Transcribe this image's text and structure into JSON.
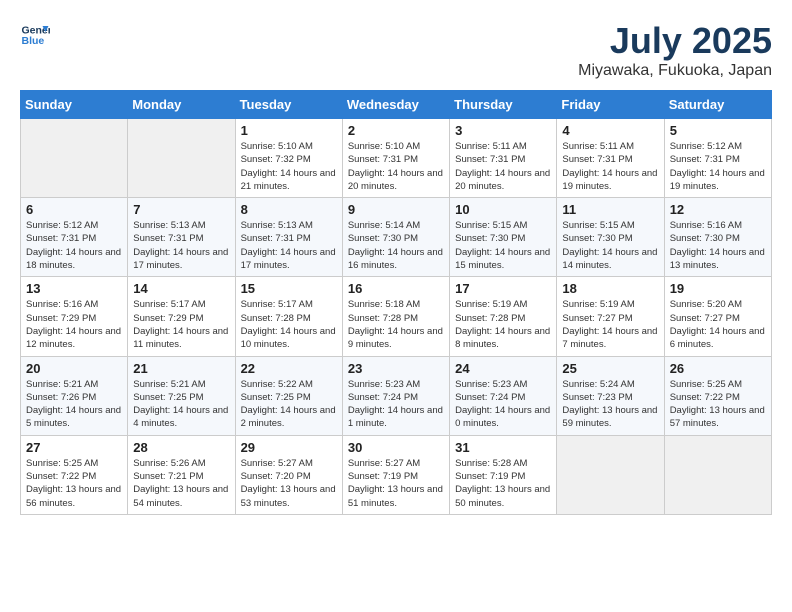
{
  "header": {
    "logo_line1": "General",
    "logo_line2": "Blue",
    "month_year": "July 2025",
    "location": "Miyawaka, Fukuoka, Japan"
  },
  "days_of_week": [
    "Sunday",
    "Monday",
    "Tuesday",
    "Wednesday",
    "Thursday",
    "Friday",
    "Saturday"
  ],
  "weeks": [
    [
      {
        "day": "",
        "sunrise": "",
        "sunset": "",
        "daylight": ""
      },
      {
        "day": "",
        "sunrise": "",
        "sunset": "",
        "daylight": ""
      },
      {
        "day": "1",
        "sunrise": "Sunrise: 5:10 AM",
        "sunset": "Sunset: 7:32 PM",
        "daylight": "Daylight: 14 hours and 21 minutes."
      },
      {
        "day": "2",
        "sunrise": "Sunrise: 5:10 AM",
        "sunset": "Sunset: 7:31 PM",
        "daylight": "Daylight: 14 hours and 20 minutes."
      },
      {
        "day": "3",
        "sunrise": "Sunrise: 5:11 AM",
        "sunset": "Sunset: 7:31 PM",
        "daylight": "Daylight: 14 hours and 20 minutes."
      },
      {
        "day": "4",
        "sunrise": "Sunrise: 5:11 AM",
        "sunset": "Sunset: 7:31 PM",
        "daylight": "Daylight: 14 hours and 19 minutes."
      },
      {
        "day": "5",
        "sunrise": "Sunrise: 5:12 AM",
        "sunset": "Sunset: 7:31 PM",
        "daylight": "Daylight: 14 hours and 19 minutes."
      }
    ],
    [
      {
        "day": "6",
        "sunrise": "Sunrise: 5:12 AM",
        "sunset": "Sunset: 7:31 PM",
        "daylight": "Daylight: 14 hours and 18 minutes."
      },
      {
        "day": "7",
        "sunrise": "Sunrise: 5:13 AM",
        "sunset": "Sunset: 7:31 PM",
        "daylight": "Daylight: 14 hours and 17 minutes."
      },
      {
        "day": "8",
        "sunrise": "Sunrise: 5:13 AM",
        "sunset": "Sunset: 7:31 PM",
        "daylight": "Daylight: 14 hours and 17 minutes."
      },
      {
        "day": "9",
        "sunrise": "Sunrise: 5:14 AM",
        "sunset": "Sunset: 7:30 PM",
        "daylight": "Daylight: 14 hours and 16 minutes."
      },
      {
        "day": "10",
        "sunrise": "Sunrise: 5:15 AM",
        "sunset": "Sunset: 7:30 PM",
        "daylight": "Daylight: 14 hours and 15 minutes."
      },
      {
        "day": "11",
        "sunrise": "Sunrise: 5:15 AM",
        "sunset": "Sunset: 7:30 PM",
        "daylight": "Daylight: 14 hours and 14 minutes."
      },
      {
        "day": "12",
        "sunrise": "Sunrise: 5:16 AM",
        "sunset": "Sunset: 7:30 PM",
        "daylight": "Daylight: 14 hours and 13 minutes."
      }
    ],
    [
      {
        "day": "13",
        "sunrise": "Sunrise: 5:16 AM",
        "sunset": "Sunset: 7:29 PM",
        "daylight": "Daylight: 14 hours and 12 minutes."
      },
      {
        "day": "14",
        "sunrise": "Sunrise: 5:17 AM",
        "sunset": "Sunset: 7:29 PM",
        "daylight": "Daylight: 14 hours and 11 minutes."
      },
      {
        "day": "15",
        "sunrise": "Sunrise: 5:17 AM",
        "sunset": "Sunset: 7:28 PM",
        "daylight": "Daylight: 14 hours and 10 minutes."
      },
      {
        "day": "16",
        "sunrise": "Sunrise: 5:18 AM",
        "sunset": "Sunset: 7:28 PM",
        "daylight": "Daylight: 14 hours and 9 minutes."
      },
      {
        "day": "17",
        "sunrise": "Sunrise: 5:19 AM",
        "sunset": "Sunset: 7:28 PM",
        "daylight": "Daylight: 14 hours and 8 minutes."
      },
      {
        "day": "18",
        "sunrise": "Sunrise: 5:19 AM",
        "sunset": "Sunset: 7:27 PM",
        "daylight": "Daylight: 14 hours and 7 minutes."
      },
      {
        "day": "19",
        "sunrise": "Sunrise: 5:20 AM",
        "sunset": "Sunset: 7:27 PM",
        "daylight": "Daylight: 14 hours and 6 minutes."
      }
    ],
    [
      {
        "day": "20",
        "sunrise": "Sunrise: 5:21 AM",
        "sunset": "Sunset: 7:26 PM",
        "daylight": "Daylight: 14 hours and 5 minutes."
      },
      {
        "day": "21",
        "sunrise": "Sunrise: 5:21 AM",
        "sunset": "Sunset: 7:25 PM",
        "daylight": "Daylight: 14 hours and 4 minutes."
      },
      {
        "day": "22",
        "sunrise": "Sunrise: 5:22 AM",
        "sunset": "Sunset: 7:25 PM",
        "daylight": "Daylight: 14 hours and 2 minutes."
      },
      {
        "day": "23",
        "sunrise": "Sunrise: 5:23 AM",
        "sunset": "Sunset: 7:24 PM",
        "daylight": "Daylight: 14 hours and 1 minute."
      },
      {
        "day": "24",
        "sunrise": "Sunrise: 5:23 AM",
        "sunset": "Sunset: 7:24 PM",
        "daylight": "Daylight: 14 hours and 0 minutes."
      },
      {
        "day": "25",
        "sunrise": "Sunrise: 5:24 AM",
        "sunset": "Sunset: 7:23 PM",
        "daylight": "Daylight: 13 hours and 59 minutes."
      },
      {
        "day": "26",
        "sunrise": "Sunrise: 5:25 AM",
        "sunset": "Sunset: 7:22 PM",
        "daylight": "Daylight: 13 hours and 57 minutes."
      }
    ],
    [
      {
        "day": "27",
        "sunrise": "Sunrise: 5:25 AM",
        "sunset": "Sunset: 7:22 PM",
        "daylight": "Daylight: 13 hours and 56 minutes."
      },
      {
        "day": "28",
        "sunrise": "Sunrise: 5:26 AM",
        "sunset": "Sunset: 7:21 PM",
        "daylight": "Daylight: 13 hours and 54 minutes."
      },
      {
        "day": "29",
        "sunrise": "Sunrise: 5:27 AM",
        "sunset": "Sunset: 7:20 PM",
        "daylight": "Daylight: 13 hours and 53 minutes."
      },
      {
        "day": "30",
        "sunrise": "Sunrise: 5:27 AM",
        "sunset": "Sunset: 7:19 PM",
        "daylight": "Daylight: 13 hours and 51 minutes."
      },
      {
        "day": "31",
        "sunrise": "Sunrise: 5:28 AM",
        "sunset": "Sunset: 7:19 PM",
        "daylight": "Daylight: 13 hours and 50 minutes."
      },
      {
        "day": "",
        "sunrise": "",
        "sunset": "",
        "daylight": ""
      },
      {
        "day": "",
        "sunrise": "",
        "sunset": "",
        "daylight": ""
      }
    ]
  ]
}
